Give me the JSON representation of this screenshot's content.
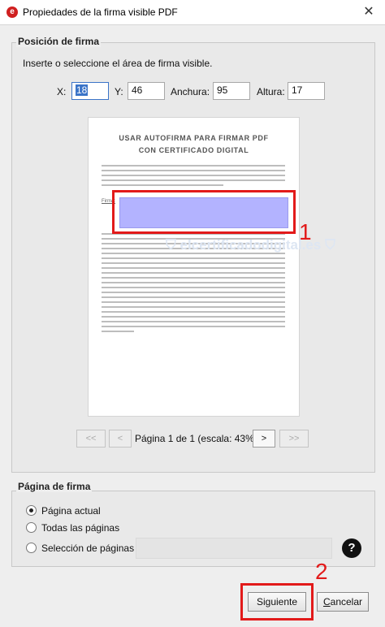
{
  "window": {
    "title": "Propiedades de la firma visible PDF",
    "close_glyph": "✕",
    "app_icon": "e"
  },
  "position": {
    "group_title": "Posición de firma",
    "instruction": "Inserte o seleccione el área de firma visible.",
    "x_label": "X:",
    "x_value": "18",
    "y_label": "Y:",
    "y_value": "46",
    "width_label": "Anchura:",
    "width_value": "95",
    "height_label": "Altura:",
    "height_value": "17"
  },
  "preview": {
    "doc_title_line1": "USAR AUTOFIRMA PARA FIRMAR PDF",
    "doc_title_line2": "CON CERTIFICADO DIGITAL",
    "signature_label": "Firma:",
    "watermark": "elcertificadodigital.es",
    "highlight_color": "#b3b3ff"
  },
  "navigation": {
    "first": "<<",
    "prev": "<",
    "page_label": "Página 1 de 1 (escala: 43%)",
    "next": ">",
    "last": ">>"
  },
  "page_section": {
    "group_title": "Página de firma",
    "options": [
      {
        "label": "Página actual",
        "checked": true
      },
      {
        "label": "Todas las páginas",
        "checked": false
      },
      {
        "label": "Selección de páginas",
        "checked": false
      }
    ],
    "help_glyph": "?"
  },
  "annotations": {
    "one": "1",
    "two": "2",
    "color": "#e21a1a"
  },
  "buttons": {
    "next": "Siguiente",
    "cancel_first": "C",
    "cancel_rest": "ancelar"
  }
}
